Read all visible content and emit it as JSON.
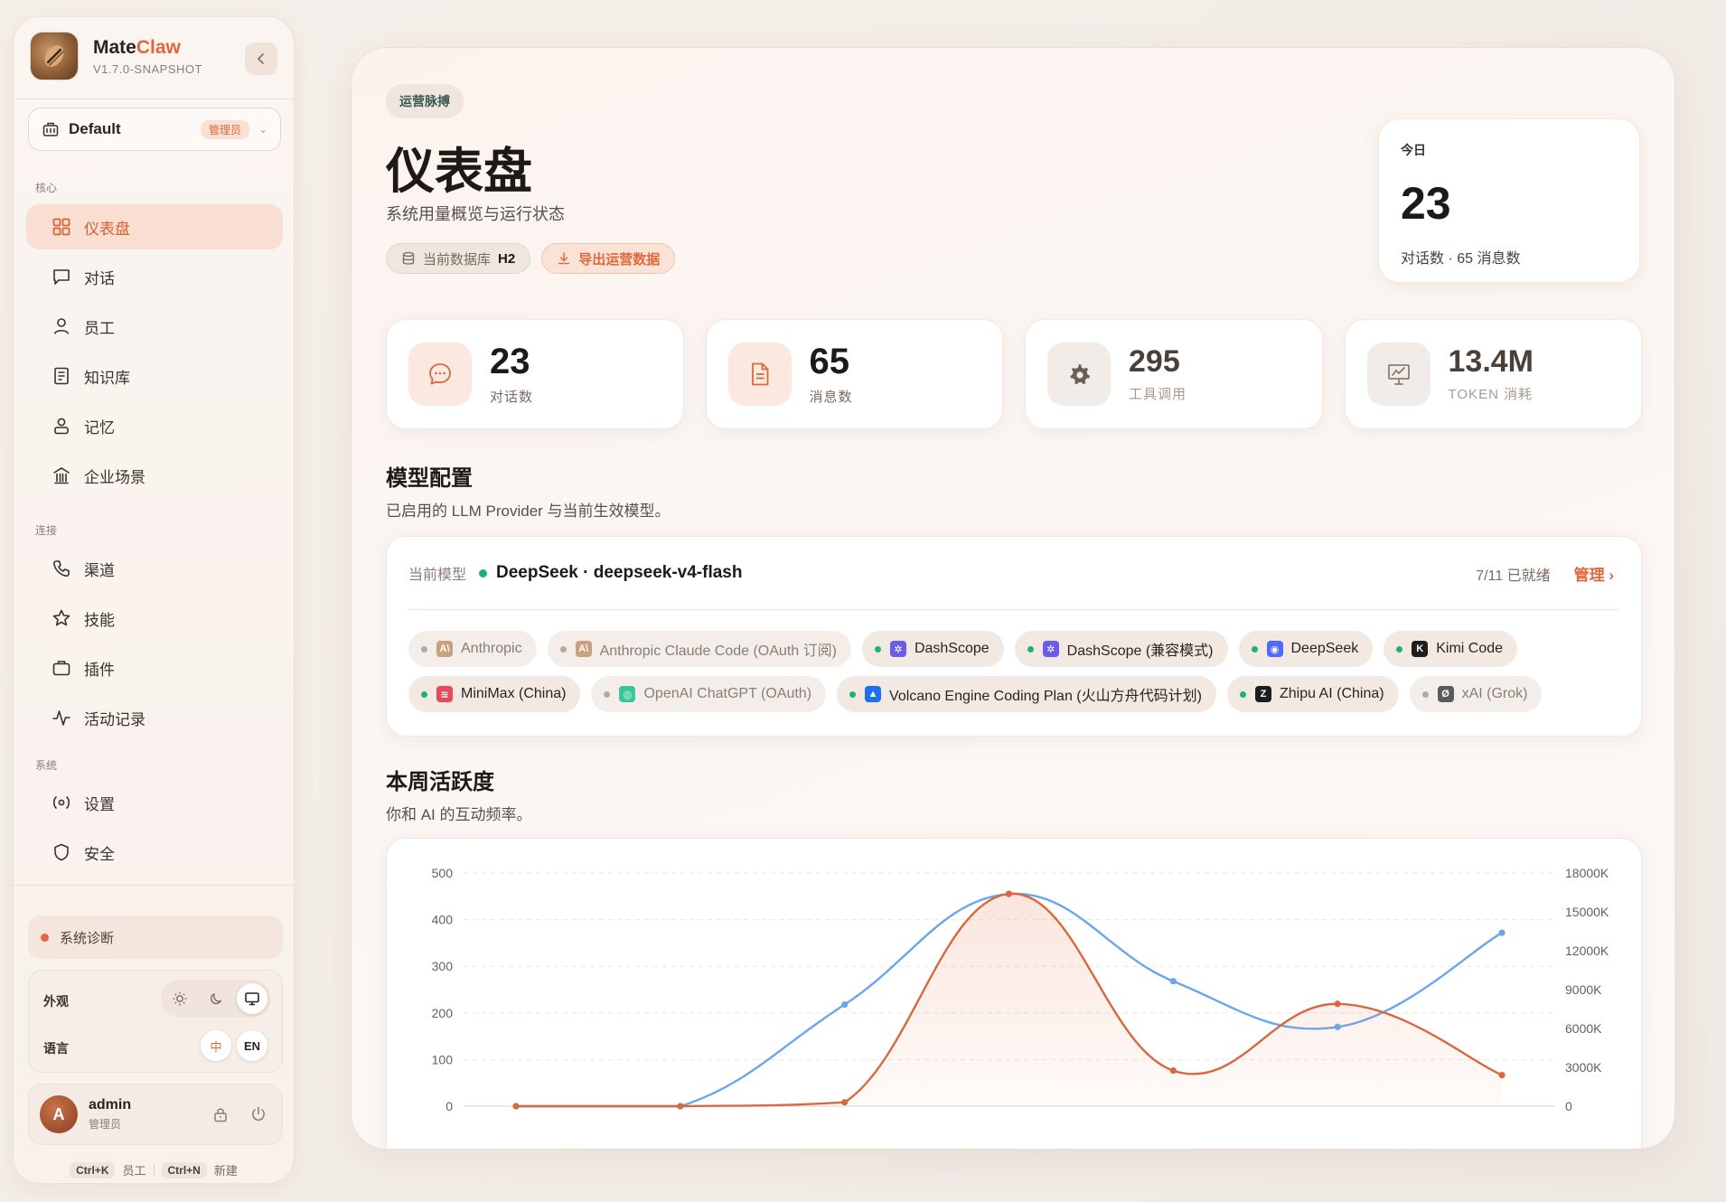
{
  "brand": {
    "name_main": "Mate",
    "name_accent": "Claw",
    "version": "V1.7.0-SNAPSHOT"
  },
  "workspace": {
    "name": "Default",
    "badge": "管理员"
  },
  "nav": {
    "groups": {
      "core": "核心",
      "connect": "连接",
      "system": "系统"
    },
    "items": [
      {
        "label": "仪表盘",
        "icon": "grid-icon",
        "active": true
      },
      {
        "label": "对话",
        "icon": "chat-icon"
      },
      {
        "label": "员工",
        "icon": "user-icon"
      },
      {
        "label": "知识库",
        "icon": "book-icon"
      },
      {
        "label": "记忆",
        "icon": "memory-icon"
      },
      {
        "label": "企业场景",
        "icon": "building-icon"
      },
      {
        "label": "渠道",
        "icon": "phone-icon"
      },
      {
        "label": "技能",
        "icon": "star-icon"
      },
      {
        "label": "插件",
        "icon": "briefcase-icon"
      },
      {
        "label": "活动记录",
        "icon": "activity-icon"
      },
      {
        "label": "设置",
        "icon": "settings-icon"
      },
      {
        "label": "安全",
        "icon": "shield-icon"
      }
    ]
  },
  "diagnostics": {
    "label": "系统诊断"
  },
  "prefs": {
    "appearance_label": "外观",
    "language_label": "语言",
    "lang_zh": "中",
    "lang_en": "EN"
  },
  "user": {
    "initial": "A",
    "name": "admin",
    "role": "管理员"
  },
  "shortcuts": {
    "k1": "Ctrl+K",
    "k1_label": "员工",
    "k2": "Ctrl+N",
    "k2_label": "新建"
  },
  "header": {
    "tag": "运营脉搏",
    "title": "仪表盘",
    "subtitle": "系统用量概览与运行状态",
    "db_label": "当前数据库",
    "db_value": "H2",
    "export_label": "导出运营数据"
  },
  "today": {
    "label": "今日",
    "value": "23",
    "summary": "对话数 · 65 消息数"
  },
  "stats": [
    {
      "value": "23",
      "label": "对话数",
      "icon": "chat-bubble-icon"
    },
    {
      "value": "65",
      "label": "消息数",
      "icon": "document-icon"
    },
    {
      "value": "295",
      "label": "工具调用",
      "icon": "gear-icon"
    },
    {
      "value": "13.4M",
      "label": "TOKEN 消耗",
      "icon": "presentation-chart-icon"
    }
  ],
  "models": {
    "title": "模型配置",
    "subtitle": "已启用的 LLM Provider 与当前生效模型。",
    "current_label": "当前模型",
    "current_value": "DeepSeek · deepseek-v4-flash",
    "ready": "7/11 已就绪",
    "manage": "管理",
    "providers_row1": [
      {
        "name": "Anthropic",
        "on": false,
        "logo": "A\\",
        "color": "#c9a27e"
      },
      {
        "name": "Anthropic Claude Code (OAuth 订阅)",
        "on": false,
        "logo": "A\\",
        "color": "#c9a27e"
      },
      {
        "name": "DashScope",
        "on": true,
        "logo": "✲",
        "color": "#6d5ce8"
      },
      {
        "name": "DashScope (兼容模式)",
        "on": true,
        "logo": "✲",
        "color": "#6d5ce8"
      },
      {
        "name": "DeepSeek",
        "on": true,
        "logo": "◉",
        "color": "#4d6bfe"
      },
      {
        "name": "Kimi Code",
        "on": true,
        "logo": "K",
        "color": "#1e1e1e"
      }
    ],
    "providers_row2": [
      {
        "name": "MiniMax (China)",
        "on": true,
        "logo": "≋",
        "color": "#e8485a"
      },
      {
        "name": "OpenAI ChatGPT (OAuth)",
        "on": false,
        "logo": "◎",
        "color": "#3ac59a"
      },
      {
        "name": "Volcano Engine Coding Plan (火山方舟代码计划)",
        "on": true,
        "logo": "▲",
        "color": "#1f6ff0"
      },
      {
        "name": "Zhipu AI (China)",
        "on": true,
        "logo": "Z",
        "color": "#1e1e1e"
      },
      {
        "name": "xAI (Grok)",
        "on": false,
        "logo": "Ø",
        "color": "#5a5a5a"
      }
    ]
  },
  "activity": {
    "title": "本周活跃度",
    "subtitle": "你和 AI 的互动频率。"
  },
  "chart_data": {
    "type": "line",
    "title": "",
    "xlabel": "",
    "ylabel": "",
    "ylim": [
      0,
      500
    ],
    "y2lim": [
      0,
      18000
    ],
    "yticks": [
      "0",
      "100",
      "200",
      "300",
      "400",
      "500"
    ],
    "y2ticks": [
      "0",
      "3000K",
      "6000K",
      "9000K",
      "12000K",
      "15000K",
      "18000K"
    ],
    "grid": true,
    "series": [
      {
        "color": "#6aa6f0",
        "axis": "left",
        "values": [
          0,
          0,
          218,
          455,
          268,
          170,
          372
        ]
      },
      {
        "color": "#d8693f",
        "axis": "right",
        "values": [
          0,
          0,
          300,
          16400,
          2750,
          7900,
          2400
        ],
        "area": true
      }
    ]
  }
}
